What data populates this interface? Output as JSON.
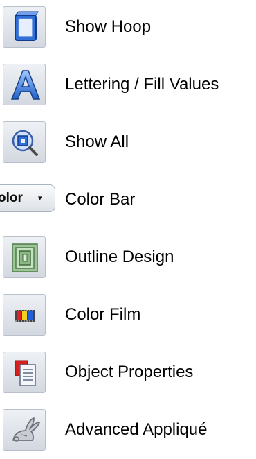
{
  "tools": [
    {
      "label": "Show Hoop",
      "icon": "hoop-icon"
    },
    {
      "label": "Lettering / Fill Values",
      "icon": "lettering-icon"
    },
    {
      "label": "Show All",
      "icon": "zoom-show-all-icon"
    },
    {
      "label": "Color Bar",
      "icon": "color-dropdown-button",
      "button_text": "olor",
      "button_arrow": "▾"
    },
    {
      "label": "Outline Design",
      "icon": "outline-design-icon"
    },
    {
      "label": "Color Film",
      "icon": "color-film-icon"
    },
    {
      "label": "Object Properties",
      "icon": "object-properties-icon"
    },
    {
      "label": "Advanced Appliqué",
      "icon": "applique-rabbit-icon"
    }
  ]
}
